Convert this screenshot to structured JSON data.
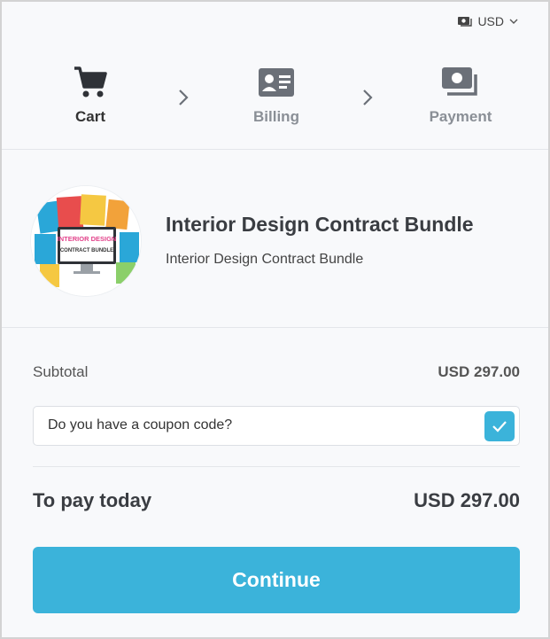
{
  "currency": {
    "label": "USD",
    "icon": "money-icon",
    "dropdown_icon": "chevron-down-icon"
  },
  "steps": [
    {
      "label": "Cart",
      "icon": "cart-icon",
      "active": true
    },
    {
      "label": "Billing",
      "icon": "id-card-icon",
      "active": false
    },
    {
      "label": "Payment",
      "icon": "money-stack-icon",
      "active": false
    }
  ],
  "product": {
    "title": "Interior Design Contract Bundle",
    "subtitle": "Interior Design Contract Bundle",
    "image_text": [
      "INTERIOR DESIGN",
      "CONTRACT BUNDLE"
    ]
  },
  "summary": {
    "subtotal_label": "Subtotal",
    "subtotal_amount": "USD 297.00",
    "coupon_label": "Do you have a coupon code?",
    "coupon_checked": true,
    "total_label": "To pay today",
    "total_amount": "USD 297.00"
  },
  "actions": {
    "continue_label": "Continue"
  },
  "colors": {
    "accent": "#3bb3da",
    "text_dark": "#3a3d42",
    "muted": "#8a8f96"
  }
}
